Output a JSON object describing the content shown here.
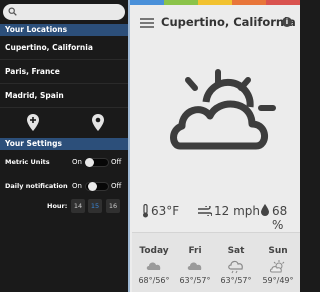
{
  "drawer": {
    "locations_header": "Your Locations",
    "locations": [
      {
        "label": "Cupertino, California"
      },
      {
        "label": "Paris, France"
      },
      {
        "label": "Madrid, Spain"
      }
    ],
    "settings_header": "Your Settings",
    "metric_units": {
      "label": "Metric Units",
      "on_label": "On",
      "off_label": "Off",
      "state": "off"
    },
    "daily_notification": {
      "label": "Daily notification",
      "on_label": "On",
      "off_label": "Off",
      "state": "on"
    },
    "hour": {
      "label": "Hour:",
      "values": [
        "14",
        "15",
        "16"
      ],
      "selected": "15"
    }
  },
  "header": {
    "city": "Cupertino, California",
    "info_label": "i",
    "stripe_colors": [
      "#4a90d9",
      "#8bc34a",
      "#f2c230",
      "#e8763a",
      "#d9534f"
    ]
  },
  "current": {
    "icon": "partly-cloudy-icon",
    "temperature": "63°F",
    "wind": "12 mph",
    "humidity": "68 %"
  },
  "forecast": [
    {
      "day": "Today",
      "temps": "68°/56°",
      "icon": "cloud-icon"
    },
    {
      "day": "Fri",
      "temps": "63°/57°",
      "icon": "cloud-icon"
    },
    {
      "day": "Sat",
      "temps": "63°/57°",
      "icon": "rain-cloud-icon"
    },
    {
      "day": "Sun",
      "temps": "59°/49°",
      "icon": "sun-cloud-icon"
    }
  ],
  "colors": {
    "section_header": "#2c4f7a",
    "accent": "#3a86d6"
  }
}
